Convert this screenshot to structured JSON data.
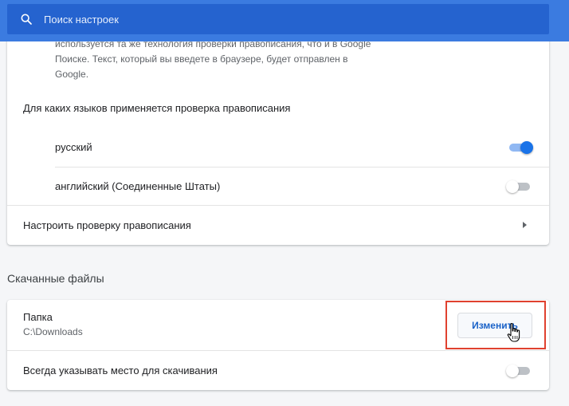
{
  "search": {
    "placeholder": "Поиск настроек"
  },
  "spellcheck": {
    "description_line1": "используется та же технология проверки правописания, что и в Google",
    "description_line2": "Поиске. Текст, который вы введете в браузере, будет отправлен в",
    "description_line3": "Google.",
    "languages_heading": "Для каких языков применяется проверка правописания",
    "languages": [
      {
        "name": "русский",
        "enabled": true
      },
      {
        "name": "английский (Соединенные Штаты)",
        "enabled": false
      }
    ],
    "configure_label": "Настроить проверку правописания"
  },
  "downloads": {
    "section_title": "Скачанные файлы",
    "folder_label": "Папка",
    "folder_path": "C:\\Downloads",
    "change_button": "Изменить",
    "ask_location_label": "Всегда указывать место для скачивания",
    "ask_location_enabled": false
  },
  "colors": {
    "header": "#3b7be0",
    "search_field": "#2563cf",
    "accent": "#1a73e8",
    "highlight_frame": "#e0412f"
  }
}
